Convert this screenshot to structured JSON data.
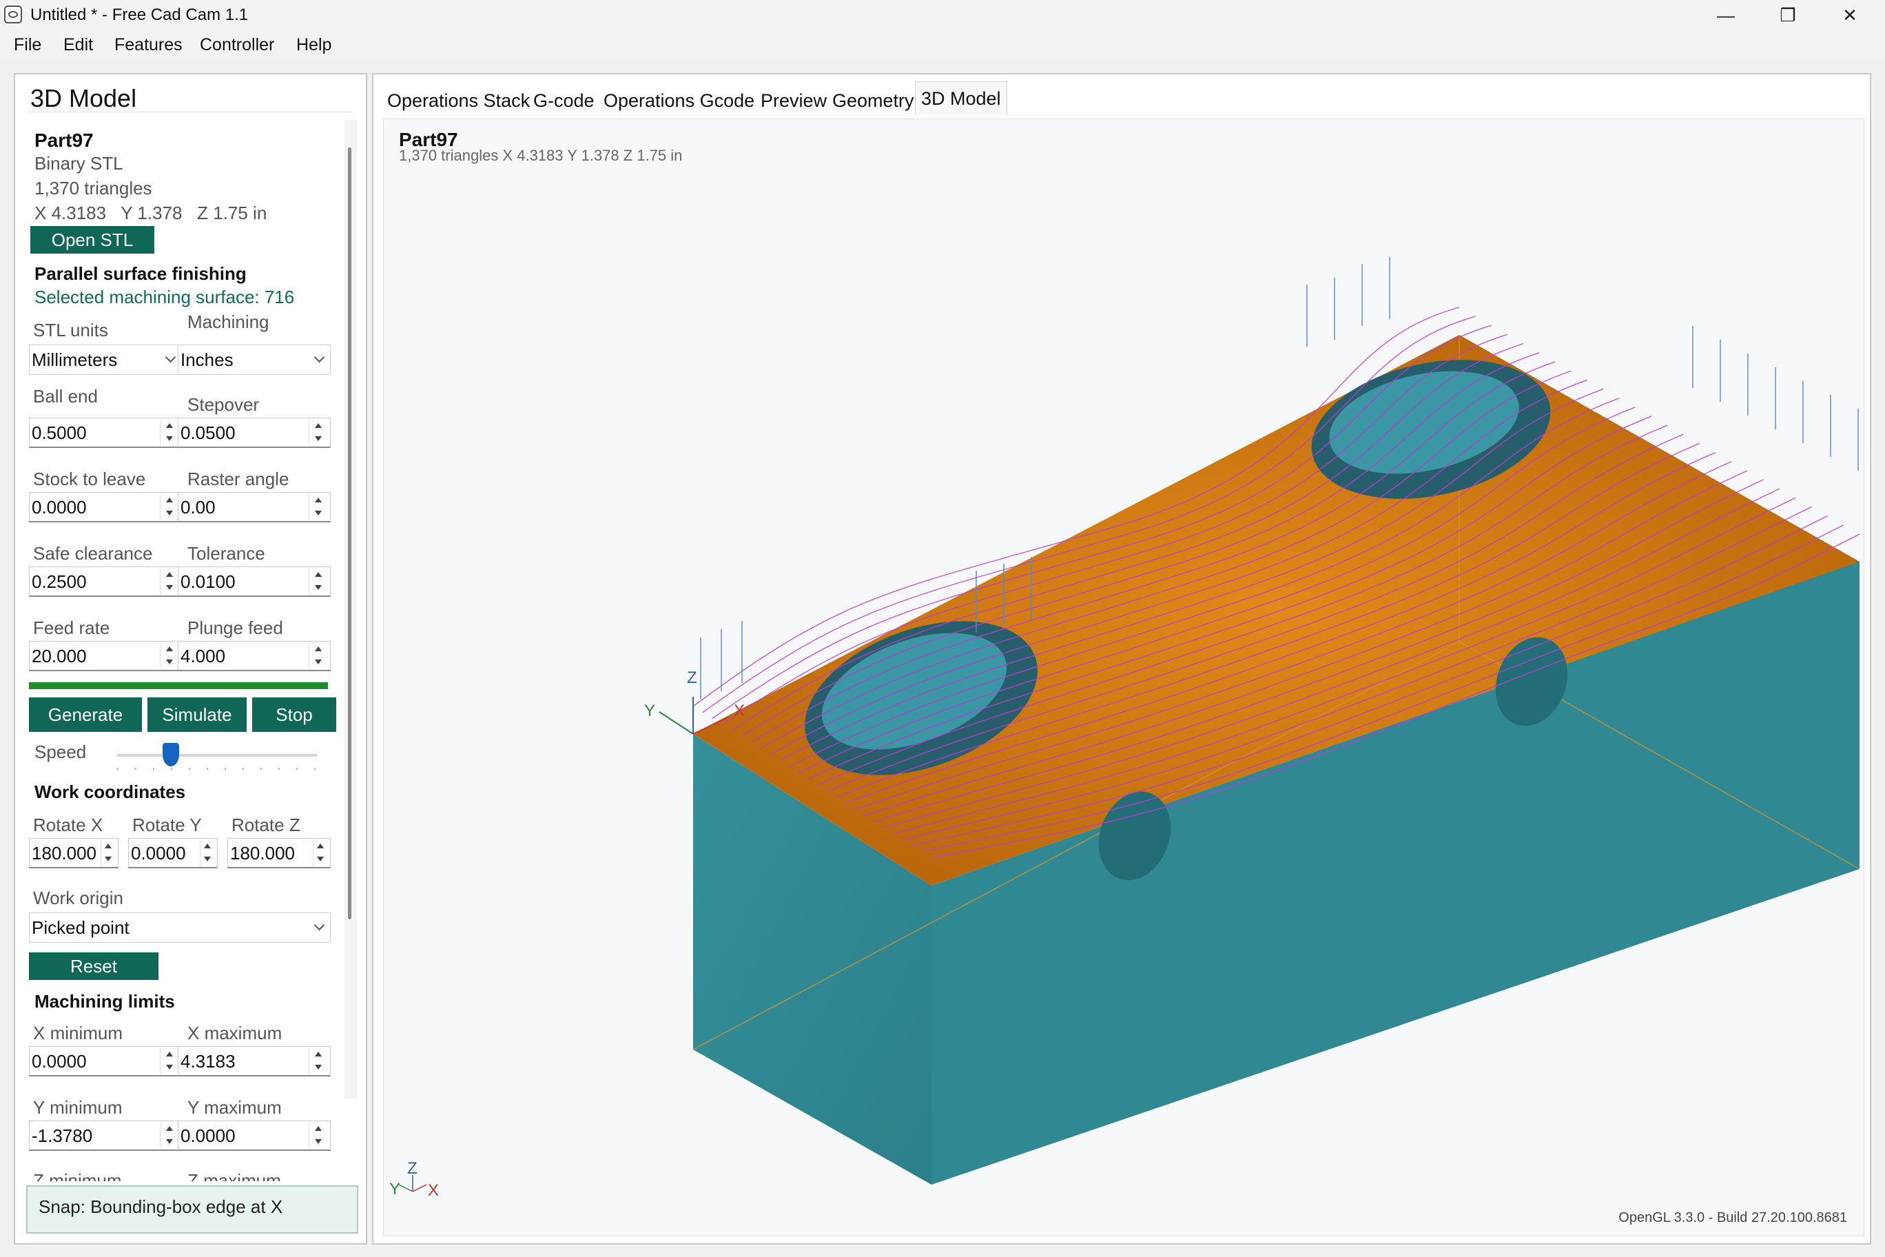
{
  "window": {
    "title": "Untitled * - Free Cad Cam 1.1",
    "min": "—",
    "max": "❐",
    "close": "✕"
  },
  "menu": [
    "File",
    "Edit",
    "Features",
    "Controller",
    "Help"
  ],
  "left": {
    "title": "3D Model",
    "part_name": "Part97",
    "file_type": "Binary STL",
    "triangles": "1,370 triangles",
    "dims": "X 4.3183   Y 1.378   Z 1.75 in",
    "open_stl": "Open STL",
    "operation": "Parallel surface finishing",
    "selected_surface": "Selected machining surface: 716",
    "stl_units_label": "STL units",
    "machining_label": "Machining",
    "stl_units": "Millimeters",
    "machining": "Inches",
    "ball_end_label": "Ball end",
    "ball_end": "0.5000",
    "stepover_label": "Stepover",
    "stepover": "0.0500",
    "stock_label": "Stock to leave",
    "stock": "0.0000",
    "raster_label": "Raster angle",
    "raster": "0.00",
    "safe_label": "Safe clearance",
    "safe": "0.2500",
    "tolerance_label": "Tolerance",
    "tolerance": "0.0100",
    "feed_label": "Feed rate",
    "feed": "20.000",
    "plunge_label": "Plunge feed",
    "plunge": "4.000",
    "generate": "Generate",
    "simulate": "Simulate",
    "stop": "Stop",
    "speed_label": "Speed",
    "speed": 0.27,
    "work_coords": "Work coordinates",
    "rotx_label": "Rotate X",
    "rotx": "180.000",
    "roty_label": "Rotate Y",
    "roty": "0.0000",
    "rotz_label": "Rotate Z",
    "rotz": "180.000",
    "origin_label": "Work origin",
    "origin": "Picked point",
    "reset": "Reset",
    "limits": "Machining limits",
    "xmin_label": "X minimum",
    "xmin": "0.0000",
    "xmax_label": "X maximum",
    "xmax": "4.3183",
    "ymin_label": "Y minimum",
    "ymin": "-1.3780",
    "ymax_label": "Y maximum",
    "ymax": "0.0000",
    "zmin_label": "Z minimum",
    "zmax_label": "Z maximum",
    "snap": "Snap: Bounding-box edge at X"
  },
  "tabs": [
    "Operations Stack",
    "G-code",
    "Operations Gcode",
    "Preview",
    "Geometry",
    "3D Model"
  ],
  "viewport": {
    "title": "Part97",
    "info": "1,370 triangles   X 4.3183   Y 1.378   Z 1.75 in",
    "footer": "OpenGL 3.3.0 - Build 27.20.100.8681",
    "axis_x": "X",
    "axis_y": "Y",
    "axis_z": "Z",
    "colors": {
      "top": "#c8740f",
      "side": "#2f8a93",
      "pocket": "#2a7a86",
      "toolpath": "#c23ad6",
      "retract": "#5a86cf"
    }
  }
}
